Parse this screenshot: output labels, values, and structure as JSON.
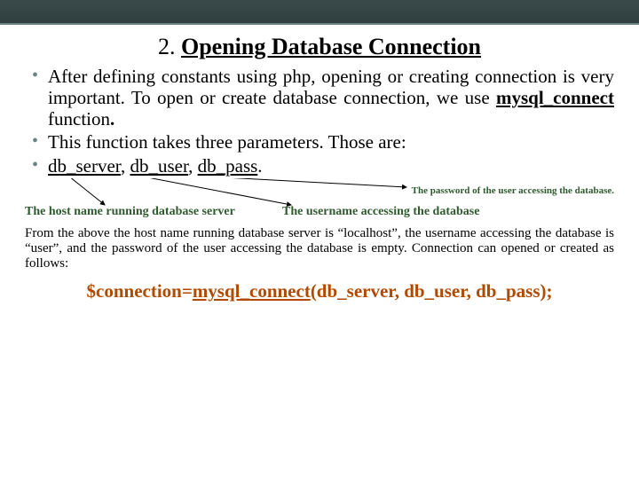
{
  "title": {
    "number": "2.",
    "text": "Opening Database Connection"
  },
  "bullets": {
    "b1_part1": "After defining constants using php, opening or creating connection is very important. To open or create database connection, we use ",
    "b1_fn": "mysql_connect",
    "b1_part2": " function",
    "b1_period": ".",
    "b2": "This function takes three parameters. Those are:",
    "b3_server": "db_server",
    "b3_c1": ", ",
    "b3_user": "db_user",
    "b3_c2": ", ",
    "b3_pass": "db_pass",
    "b3_period": "."
  },
  "annotations": {
    "pass": "The password of the user accessing the database.",
    "host": "The host name running database server",
    "user": "The username accessing the database"
  },
  "explain": "From the above the host name running database server is “localhost”, the username accessing the database is “user”, and the password of the user accessing the database is empty. Connection can opened or created as follows:",
  "code": {
    "var": "$connection",
    "eq": "=",
    "fn": "mysql_connect",
    "args": "(db_server, db_user, db_pass);"
  }
}
